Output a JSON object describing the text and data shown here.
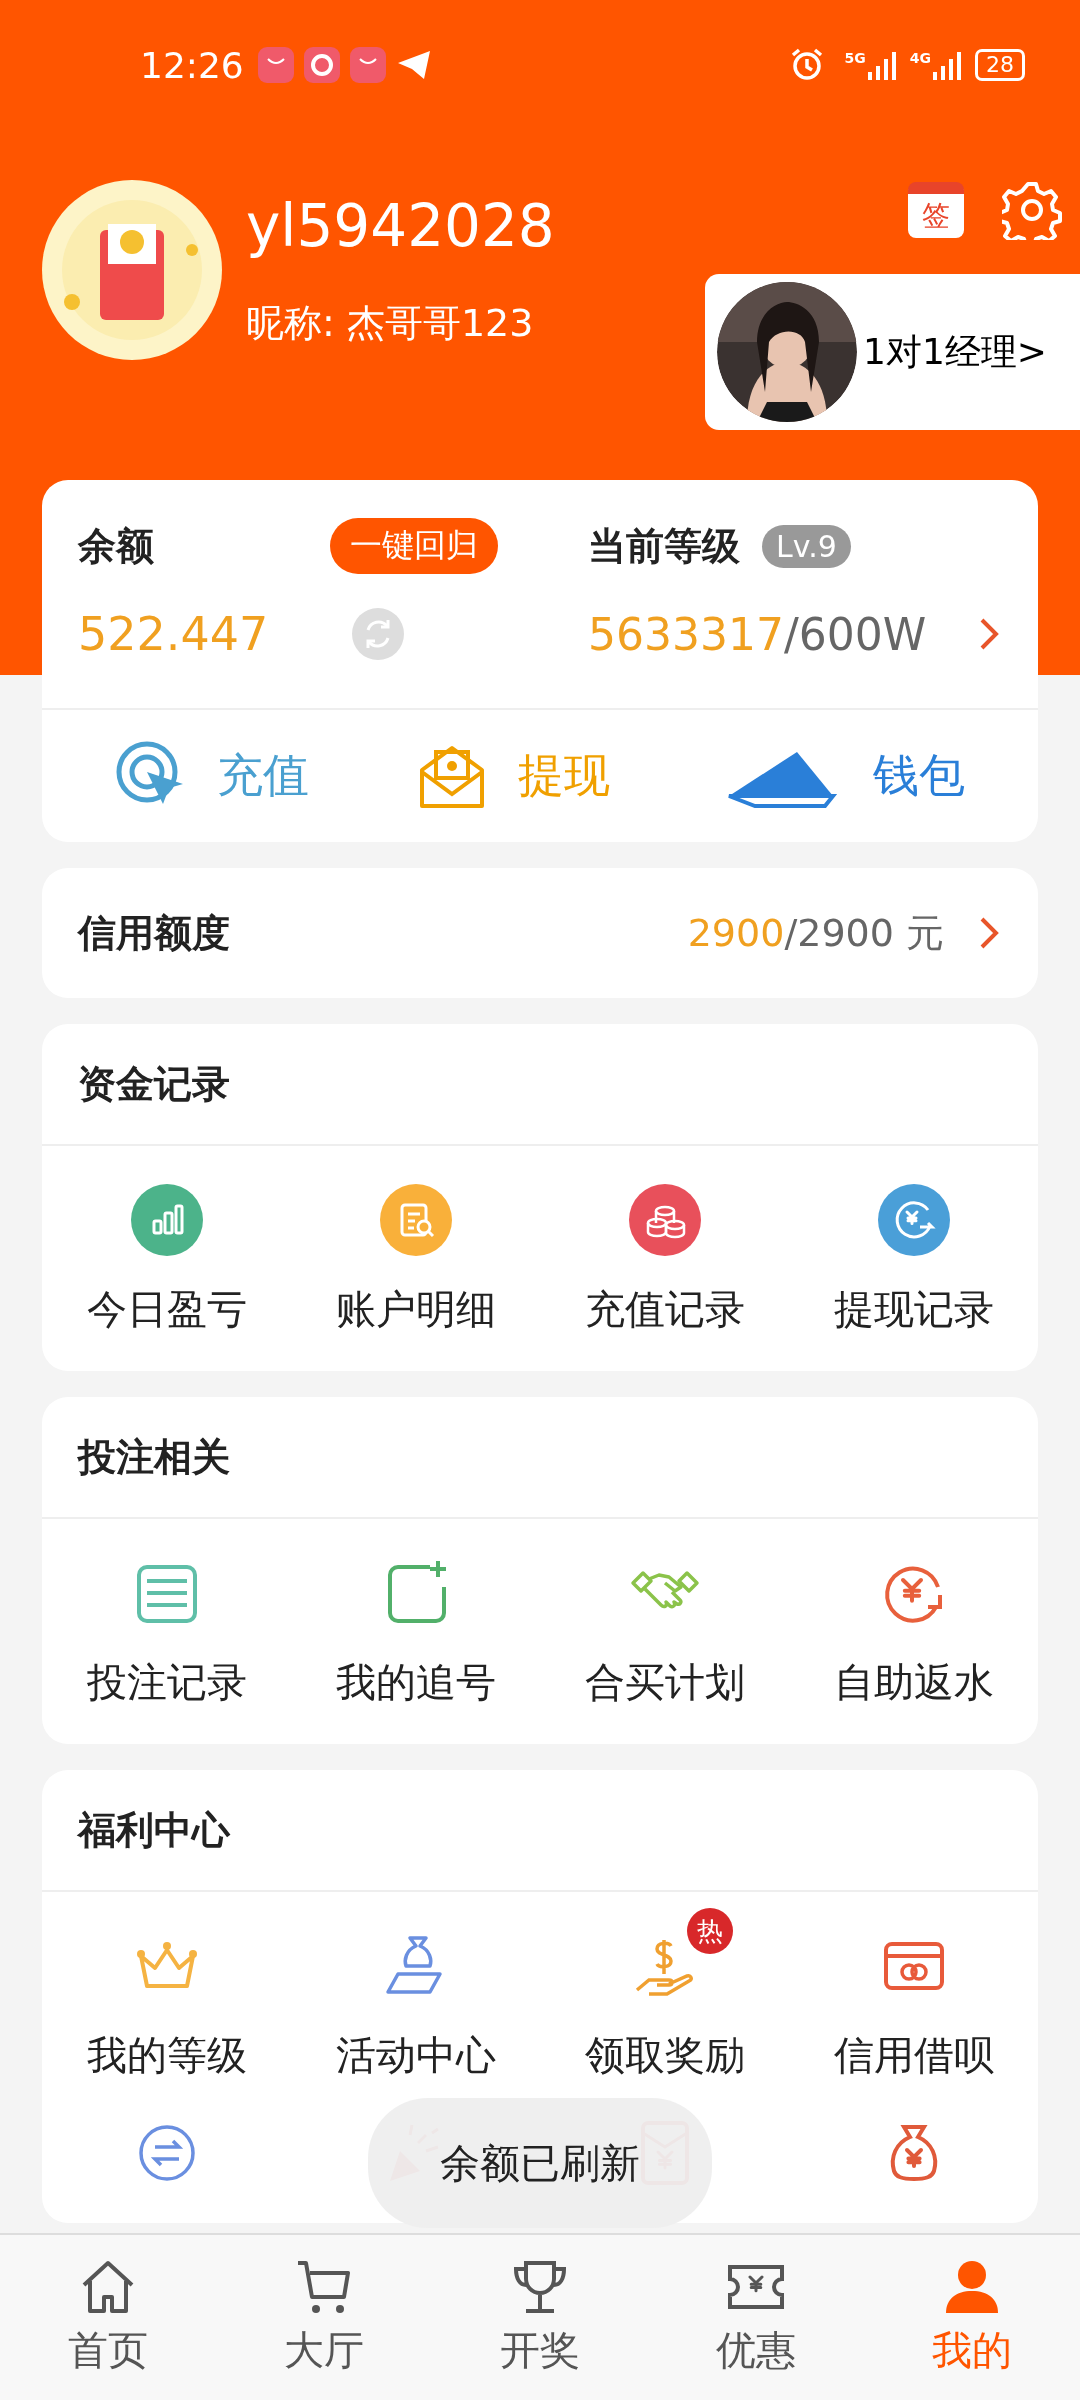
{
  "status_bar": {
    "time": "12:26",
    "network": [
      "5G",
      "4G"
    ],
    "battery": "28"
  },
  "profile": {
    "username": "yl5942028",
    "nickname": "昵称: 杰哥哥123",
    "sign_label": "签",
    "manager_label": "1对1经理>"
  },
  "balance": {
    "label": "余额",
    "return_button": "一键回归",
    "amount": "522.447",
    "level_label": "当前等级",
    "level_badge": "Lv.9",
    "points": "5633317",
    "points_target": "/600W"
  },
  "actions": [
    {
      "label": "充值"
    },
    {
      "label": "提现"
    },
    {
      "label": "钱包"
    }
  ],
  "credit": {
    "label": "信用额度",
    "used": "2900",
    "total": "/2900 元"
  },
  "sections": [
    {
      "kind": "funds",
      "title": "资金记录",
      "items": [
        {
          "kind": "labelled",
          "label": "今日盈亏"
        },
        {
          "kind": "labelled",
          "label": "账户明细"
        },
        {
          "kind": "labelled",
          "label": "充值记录"
        },
        {
          "kind": "labelled",
          "label": "提现记录"
        }
      ]
    },
    {
      "kind": "betting",
      "title": "投注相关",
      "items": [
        {
          "kind": "labelled",
          "label": "投注记录"
        },
        {
          "kind": "labelled",
          "label": "我的追号"
        },
        {
          "kind": "labelled",
          "label": "合买计划"
        },
        {
          "kind": "labelled",
          "label": "自助返水"
        }
      ]
    },
    {
      "kind": "welfare",
      "title": "福利中心",
      "items": [
        {
          "kind": "labelled",
          "label": "我的等级"
        },
        {
          "kind": "labelled",
          "label": "活动中心"
        },
        {
          "kind": "labelled",
          "label": "领取奖励",
          "badge": "热"
        },
        {
          "kind": "labelled",
          "label": "信用借呗"
        },
        {
          "kind": "icon_only"
        },
        {
          "kind": "icon_only"
        },
        {
          "kind": "icon_only"
        },
        {
          "kind": "icon_only"
        }
      ]
    }
  ],
  "toast": "余额已刷新",
  "nav": [
    {
      "label": "首页",
      "selected": false
    },
    {
      "label": "大厅",
      "selected": false
    },
    {
      "label": "开奖",
      "selected": false
    },
    {
      "label": "优惠",
      "selected": false
    },
    {
      "label": "我的",
      "selected": true
    }
  ]
}
